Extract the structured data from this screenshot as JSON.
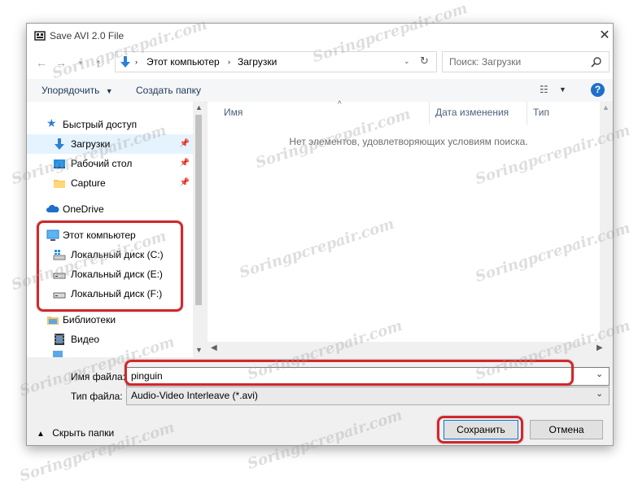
{
  "window": {
    "title": "Save AVI 2.0 File"
  },
  "address": {
    "segment1": "Этот компьютер",
    "segment2": "Загрузки"
  },
  "search": {
    "placeholder": "Поиск: Загрузки"
  },
  "toolbar": {
    "organize": "Упорядочить",
    "new_folder": "Создать папку"
  },
  "nav": {
    "quick_access": "Быстрый доступ",
    "downloads": "Загрузки",
    "desktop": "Рабочий стол",
    "capture": "Capture",
    "onedrive": "OneDrive",
    "this_pc": "Этот компьютер",
    "disk_c": "Локальный диск (C:)",
    "disk_e": "Локальный диск (E:)",
    "disk_f": "Локальный диск (F:)",
    "libraries": "Библиотеки",
    "video": "Видео"
  },
  "columns": {
    "name": "Имя",
    "date": "Дата изменения",
    "type": "Тип"
  },
  "content": {
    "empty_message": "Нет элементов, удовлетворяющих условиям поиска."
  },
  "form": {
    "filename_label": "Имя файла:",
    "filename_value": "pinguin",
    "filetype_label": "Тип файла:",
    "filetype_value": "Audio-Video Interleave (*.avi)"
  },
  "footer": {
    "hide_folders": "Скрыть папки",
    "save": "Сохранить",
    "cancel": "Отмена"
  },
  "watermark": {
    "text": "Soringpcrepair.com"
  },
  "colors": {
    "accent": "#0078d7",
    "highlight_ring": "#d3272a",
    "selected_bg": "#e5f3ff"
  }
}
